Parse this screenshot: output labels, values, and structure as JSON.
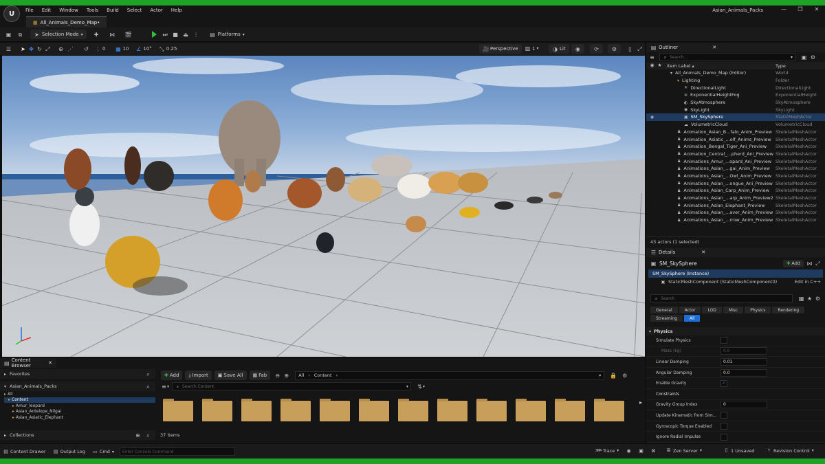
{
  "app": {
    "project_name": "Asian_Animals_Packs",
    "document_tab": "All_Animals_Demo_Map•",
    "logo_glyph": "U",
    "window_controls": [
      "—",
      "❐",
      "✕"
    ]
  },
  "menu": [
    "File",
    "Edit",
    "Window",
    "Tools",
    "Build",
    "Select",
    "Actor",
    "Help"
  ],
  "toolbar": {
    "selection_mode": "Selection Mode",
    "platforms": "Platforms"
  },
  "viewport_toolbar": {
    "rotation_snap_value": "0",
    "grid_snap_value": "10",
    "angle_snap_value": "10°",
    "scale_snap_value": "0.25",
    "perspective": "Perspective",
    "camera_speed": "1",
    "lit": "Lit"
  },
  "outliner": {
    "tab": "Outliner",
    "search_placeholder": "Search...",
    "col_label": "Item Label ▴",
    "col_type": "Type",
    "rows": [
      {
        "label": "All_Animals_Demo_Map (Editor)",
        "type": "World",
        "indent": 0,
        "icon": "▾"
      },
      {
        "label": "Lighting",
        "type": "Folder",
        "indent": 1,
        "icon": "▾"
      },
      {
        "label": "DirectionalLight",
        "type": "DirectionalLight",
        "indent": 2,
        "icon": "☀"
      },
      {
        "label": "ExponentialHeightFog",
        "type": "ExponentialHeight",
        "indent": 2,
        "icon": "≋"
      },
      {
        "label": "SkyAtmosphere",
        "type": "SkyAtmosphere",
        "indent": 2,
        "icon": "◐"
      },
      {
        "label": "SkyLight",
        "type": "SkyLight",
        "indent": 2,
        "icon": "◉"
      },
      {
        "label": "SM_SkySphere",
        "type": "StaticMeshActor",
        "indent": 2,
        "icon": "▣",
        "selected": true
      },
      {
        "label": "VolumetricCloud",
        "type": "VolumetricCloud",
        "indent": 2,
        "icon": "☁"
      },
      {
        "label": "Animation_Asian_B...falo_Anim_Preview",
        "type": "SkeletalMeshActor",
        "indent": 1,
        "icon": "♟"
      },
      {
        "label": "Animation_Asiatic_...olf_Anims_Preview",
        "type": "SkeletalMeshActor",
        "indent": 1,
        "icon": "♟"
      },
      {
        "label": "Animation_Bengal_Tiger_Ani_Preview",
        "type": "SkeletalMeshActor",
        "indent": 1,
        "icon": "♟"
      },
      {
        "label": "Animation_Central_...pherd_Ani_Preview",
        "type": "SkeletalMeshActor",
        "indent": 1,
        "icon": "♟"
      },
      {
        "label": "Animations_Amur_...opard_Ani_Preview",
        "type": "SkeletalMeshActor",
        "indent": 1,
        "icon": "♟"
      },
      {
        "label": "Animations_Asian_...gai_Anim_Preview",
        "type": "SkeletalMeshActor",
        "indent": 1,
        "icon": "♟"
      },
      {
        "label": "Animations_Asian_...Owl_Anim_Preview",
        "type": "SkeletalMeshActor",
        "indent": 1,
        "icon": "♟"
      },
      {
        "label": "Animations_Asian_...ongue_Ani_Preview",
        "type": "SkeletalMeshActor",
        "indent": 1,
        "icon": "♟"
      },
      {
        "label": "Animations_Asian_Carp_Anim_Preview",
        "type": "SkeletalMeshActor",
        "indent": 1,
        "icon": "♟"
      },
      {
        "label": "Animations_Asian_...arp_Anim_Preview2",
        "type": "SkeletalMeshActor",
        "indent": 1,
        "icon": "♟"
      },
      {
        "label": "Animations_Asian_Elephant_Preview",
        "type": "SkeletalMeshActor",
        "indent": 1,
        "icon": "♟"
      },
      {
        "label": "Animations_Asian_...aver_Anim_Preview",
        "type": "SkeletalMeshActor",
        "indent": 1,
        "icon": "♟"
      },
      {
        "label": "Animations_Asian_...rrow_Anim_Preview",
        "type": "SkeletalMeshActor",
        "indent": 1,
        "icon": "♟"
      }
    ],
    "footer": "43 actors (1 selected)"
  },
  "details": {
    "tab": "Details",
    "actor_name": "SM_SkySphere",
    "add_label": "Add",
    "instance_label": "SM_SkySphere (Instance)",
    "component_label": "StaticMeshComponent (StaticMeshComponent0)",
    "edit_cpp": "Edit in C++",
    "search_placeholder": "Search",
    "categories": [
      "General",
      "Actor",
      "LOD",
      "Misc",
      "Physics",
      "Rendering",
      "Streaming",
      "All"
    ],
    "section_physics": "Physics",
    "properties": [
      {
        "label": "Simulate Physics",
        "kind": "check",
        "value": ""
      },
      {
        "label": "Mass (kg)",
        "kind": "field",
        "value": "0.0",
        "dim": true,
        "indent": true
      },
      {
        "label": "Linear Damping",
        "kind": "field",
        "value": "0.01"
      },
      {
        "label": "Angular Damping",
        "kind": "field",
        "value": "0.0"
      },
      {
        "label": "Enable Gravity",
        "kind": "check",
        "value": "✓"
      },
      {
        "label": "Constraints",
        "kind": "section",
        "value": ""
      },
      {
        "label": "Gravity Group Index",
        "kind": "field",
        "value": "0"
      },
      {
        "label": "Update Kinematic from Simul...",
        "kind": "check",
        "value": ""
      },
      {
        "label": "Gyroscopic Torque Enabled",
        "kind": "check",
        "value": ""
      },
      {
        "label": "Ignore Radial Impulse",
        "kind": "check",
        "value": ""
      }
    ]
  },
  "content_browser": {
    "tab": "Content Browser",
    "favorites": "Favorites",
    "project": "Asian_Animals_Packs",
    "tree": [
      "All",
      "Content",
      "Amur_leopard",
      "Asian_Antelope_Nilgai",
      "Asian_Asiatic_Elephant"
    ],
    "collections": "Collections",
    "add": "Add",
    "import": "Import",
    "save_all": "Save All",
    "fab": "Fab",
    "path": [
      "All",
      "Content"
    ],
    "search_placeholder": "Search Content",
    "folder_count": 12,
    "items_count": "37 items"
  },
  "statusbar": {
    "content_drawer": "Content Drawer",
    "output_log": "Output Log",
    "cmd": "Cmd",
    "console_placeholder": "Enter Console Command",
    "trace": "Trace",
    "zen_server": "Zen Server",
    "unsaved": "1 Unsaved",
    "revision_control": "Revision Control"
  }
}
